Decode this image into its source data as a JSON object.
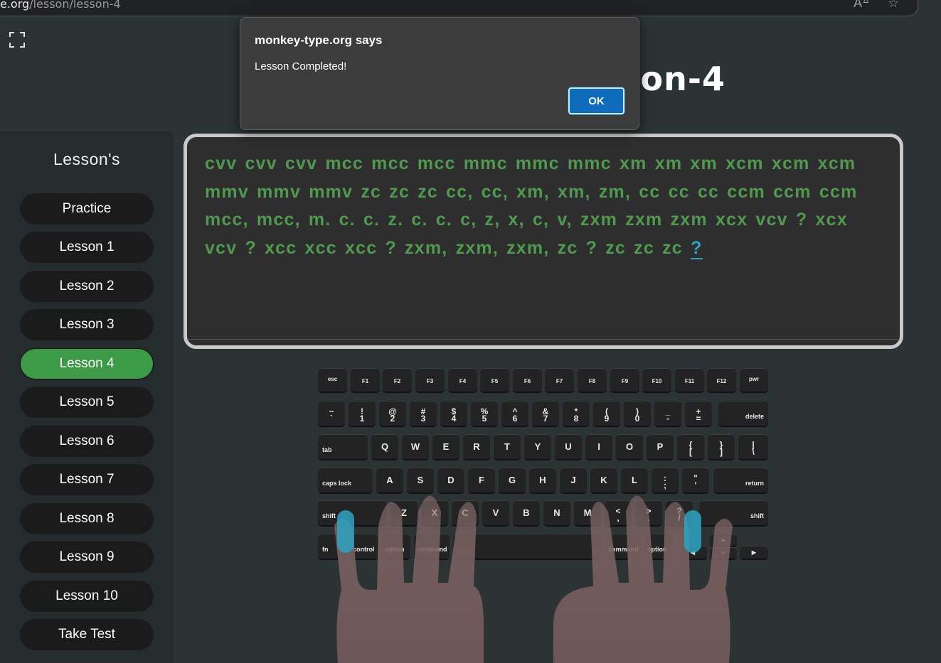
{
  "browser": {
    "url_host": "e.org",
    "url_path": "/lesson/lesson-4"
  },
  "page": {
    "title": "Lesson-4"
  },
  "sidebar": {
    "title": "Lesson's",
    "items": [
      {
        "label": "Practice"
      },
      {
        "label": "Lesson 1"
      },
      {
        "label": "Lesson 2"
      },
      {
        "label": "Lesson 3"
      },
      {
        "label": "Lesson 4",
        "active": true
      },
      {
        "label": "Lesson 5"
      },
      {
        "label": "Lesson 6"
      },
      {
        "label": "Lesson 7"
      },
      {
        "label": "Lesson 8"
      },
      {
        "label": "Lesson 9"
      },
      {
        "label": "Lesson 10"
      },
      {
        "label": "Take Test"
      }
    ]
  },
  "lesson": {
    "text": "cvv cvv cvv mcc mcc mcc mmc mmc mmc xm xm xm xcm xcm xcm mmv mmv mmv zc zc zc cc, cc, xm, xm, zm, cc cc cc ccm ccm ccm mcc, mcc, m. c. c. z. c. c. c, z, x, c, v, zxm zxm zxm xcx vcv ? xcx vcv ? xcc xcc xcc ? zxm, zxm, zxm, zc ? zc zc zc ",
    "cursor_char": "?"
  },
  "keyboard": {
    "function_row": [
      "esc",
      "F1",
      "F2",
      "F3",
      "F4",
      "F5",
      "F6",
      "F7",
      "F8",
      "F9",
      "F10",
      "F11",
      "F12",
      "pwr"
    ],
    "number_row": [
      [
        "~",
        "`"
      ],
      [
        "!",
        "1"
      ],
      [
        "@",
        "2"
      ],
      [
        "#",
        "3"
      ],
      [
        "$",
        "4"
      ],
      [
        "%",
        "5"
      ],
      [
        "^",
        "6"
      ],
      [
        "&",
        "7"
      ],
      [
        "*",
        "8"
      ],
      [
        "(",
        "9"
      ],
      [
        ")",
        "0"
      ],
      [
        "_",
        "-"
      ],
      [
        "+",
        "="
      ]
    ],
    "delete": "delete",
    "tab": "tab",
    "qwerty_row": [
      "Q",
      "W",
      "E",
      "R",
      "T",
      "Y",
      "U",
      "I",
      "O",
      "P"
    ],
    "qwerty_symbols": [
      [
        "{",
        "["
      ],
      [
        "}",
        "]"
      ],
      [
        "|",
        "\\"
      ]
    ],
    "caps": "caps lock",
    "home_row": [
      "A",
      "S",
      "D",
      "F",
      "G",
      "H",
      "J",
      "K",
      "L"
    ],
    "home_symbols": [
      [
        ":",
        ";"
      ],
      [
        "\"",
        "'"
      ]
    ],
    "return": "return",
    "shift": "shift",
    "bottom_letters": [
      "Z",
      "X",
      "C",
      "V",
      "B",
      "N",
      "M"
    ],
    "bottom_symbols": [
      [
        "<",
        ","
      ],
      [
        ">",
        "."
      ],
      [
        "?",
        "/"
      ]
    ],
    "mod_row": [
      "fn",
      "control",
      "option",
      "command",
      "command",
      "option"
    ],
    "arrows": [
      "◀",
      "▲",
      "▼",
      "▶"
    ]
  },
  "dialog": {
    "title": "monkey-type.org says",
    "message": "Lesson Completed!",
    "ok_label": "OK"
  },
  "colors": {
    "accent_green": "#3d9a47",
    "text_green": "#4f9a4e",
    "cursor_blue": "#2ea3c2",
    "ok_blue": "#0f6cbd"
  }
}
